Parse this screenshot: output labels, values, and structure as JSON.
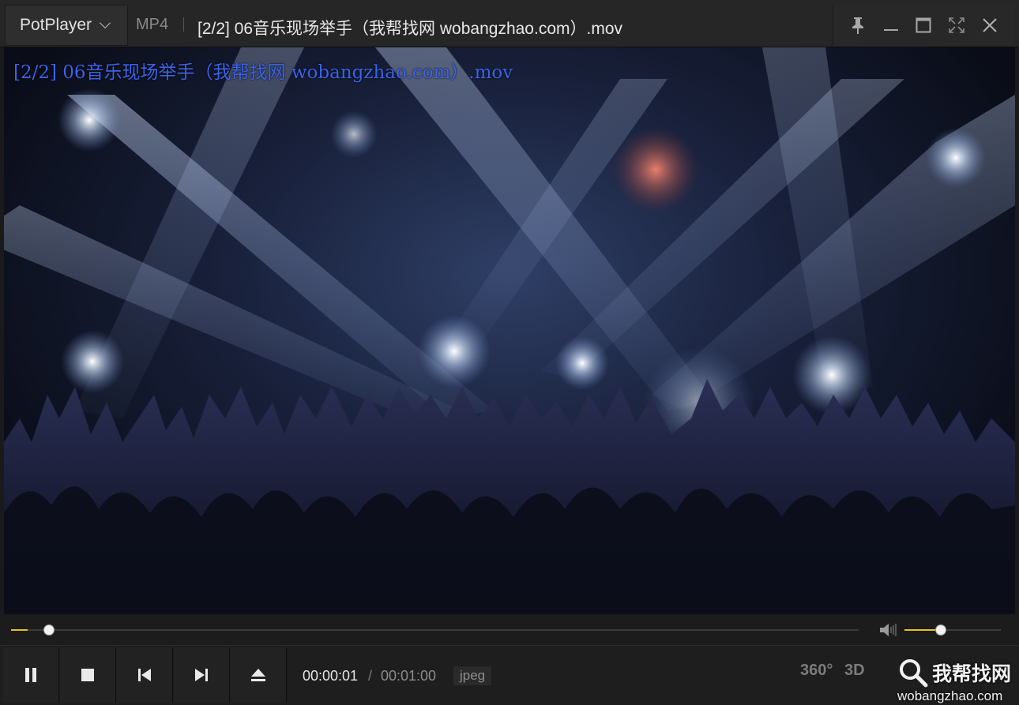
{
  "app": {
    "logo_text": "PotPlayer",
    "format_badge": "MP4",
    "window_title": "[2/2] 06音乐现场举手（我帮找网 wobangzhao.com）.mov"
  },
  "window_controls": [
    "pin-icon",
    "minimize-icon",
    "maximize-icon",
    "fullscreen-icon",
    "close-icon"
  ],
  "video": {
    "osd_text": "[2/2] 06音乐现场举手（我帮找网 wobangzhao.com）.mov",
    "scene": "concert crowd silhouettes under stage lights"
  },
  "playback": {
    "progress_fraction": 0.02,
    "volume_fraction": 0.38,
    "current_time": "00:00:01",
    "time_separator": "/",
    "total_time": "00:01:00",
    "codec": "jpeg"
  },
  "controls": {
    "buttons": [
      "pause-icon",
      "stop-icon",
      "previous-icon",
      "next-icon",
      "eject-icon"
    ],
    "right_buttons": {
      "vr360": "360°",
      "three_d": "3D"
    }
  },
  "watermark": {
    "cn": "我帮找网",
    "en": "wobangzhao.com"
  },
  "colors": {
    "accent": "#e6c21e",
    "osd": "#3a63e8",
    "background": "#1a1a1a"
  }
}
